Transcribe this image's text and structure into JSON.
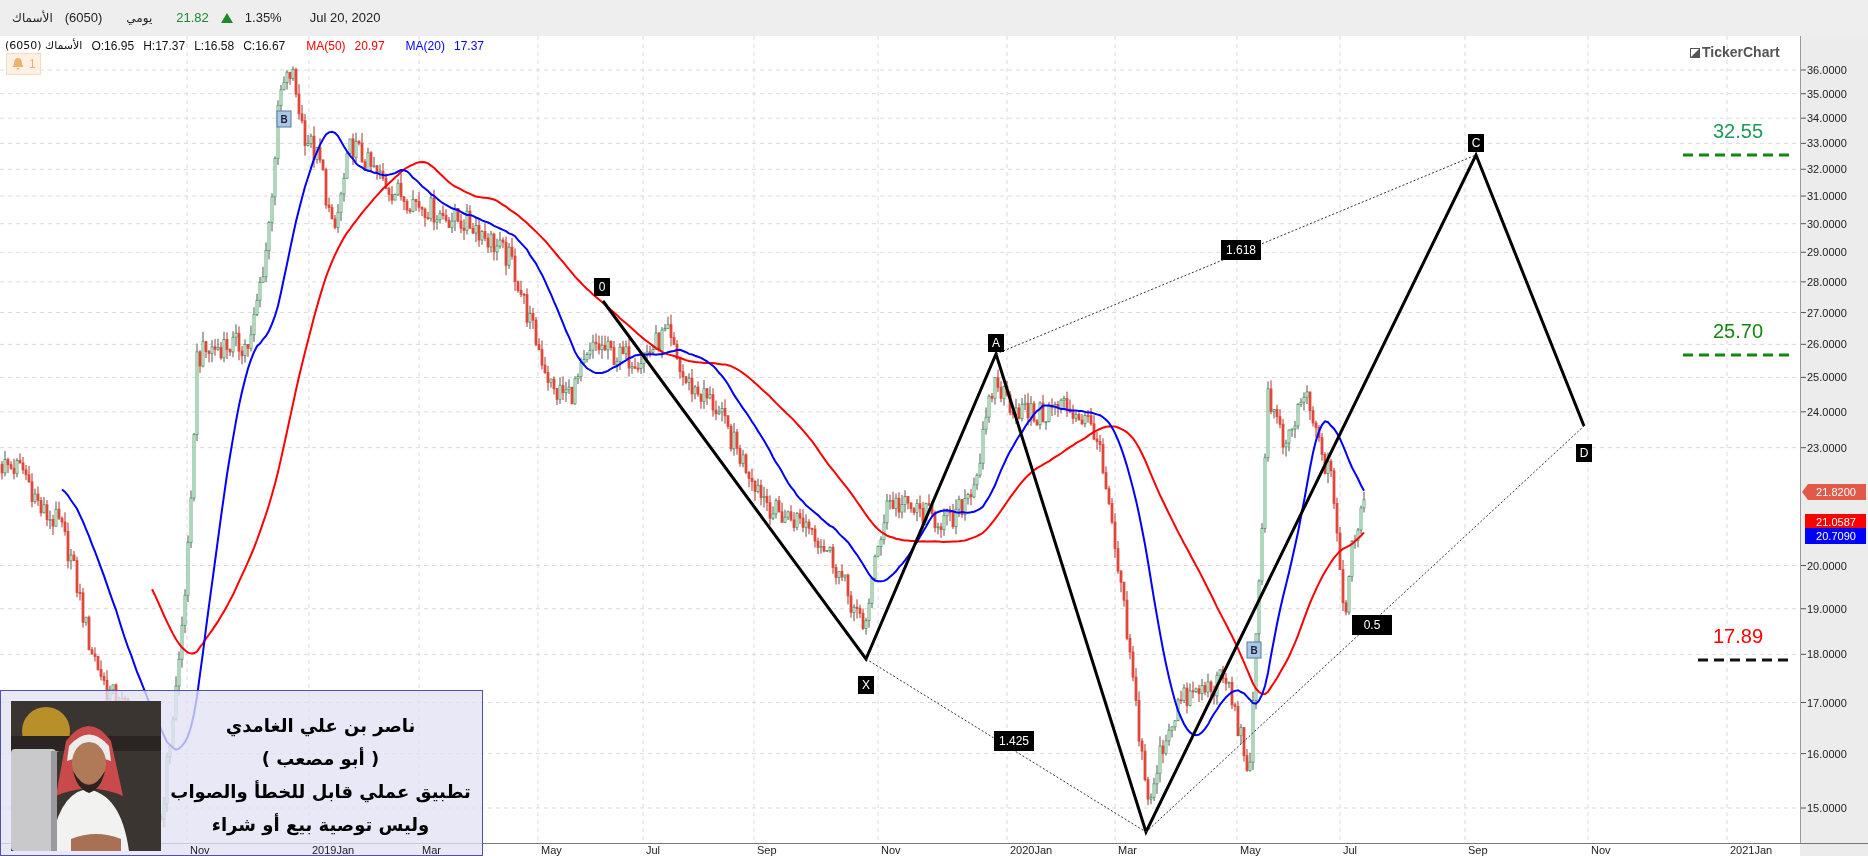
{
  "header": {
    "symbol_name": "الأسماك",
    "symbol_code": "(6050)",
    "period": "يومي",
    "last_price": "21.82",
    "change_up": true,
    "change_percent": "1.35%",
    "date": "Jul 20, 2020"
  },
  "chart": {
    "legend": {
      "symbol": "الأسماك (6050)",
      "ohlc": [
        "O:16.95",
        "H:17.37",
        "L:16.58",
        "C:16.67"
      ],
      "indicators": [
        {
          "name": "MA(50)",
          "value": "20.97",
          "color": "#ff0000"
        },
        {
          "name": "MA(20)",
          "value": "17.37",
          "color": "#0000ff"
        }
      ]
    },
    "alert_count": "1",
    "logo": "TickerChart",
    "y_ticks": [
      "36.0000",
      "35.0000",
      "34.0000",
      "33.0000",
      "32.0000",
      "31.0000",
      "30.0000",
      "29.0000",
      "28.0000",
      "27.0000",
      "26.0000",
      "25.0000",
      "24.0000",
      "23.0000",
      "20.0000",
      "19.0000",
      "18.0000",
      "17.0000",
      "16.0000",
      "15.0000"
    ],
    "x_ticks": [
      "Nov",
      "2019Jan",
      "Mar",
      "May",
      "Jul",
      "Sep",
      "Nov",
      "2020Jan",
      "Mar",
      "May",
      "Jul",
      "Sep",
      "Nov",
      "2021Jan"
    ],
    "price_tags": [
      {
        "text": "21.8200",
        "color": "#e05a47",
        "kind": "last"
      },
      {
        "text": "21.0587",
        "color": "#ff0000",
        "kind": "indicator"
      },
      {
        "text": "20.7090",
        "color": "#0000ff",
        "kind": "indicator"
      }
    ],
    "pattern_points": [
      "0",
      "X",
      "A",
      "C",
      "D"
    ],
    "ratios": [
      "1.618",
      "1.425",
      "0.5"
    ],
    "markers": [
      "B",
      "B"
    ],
    "levels": [
      {
        "value": "32.55",
        "color": "#1f9a5a",
        "kind": "target"
      },
      {
        "value": "25.70",
        "color": "#118811",
        "kind": "target"
      },
      {
        "value": "17.89",
        "color": "#ff0000",
        "kind": "stop"
      }
    ]
  },
  "overlay": {
    "lines": [
      "ناصر بن علي الغامدي",
      "( أبو مصعب )",
      "تطبيق عملي قابل للخطأ والصواب",
      "وليس توصية بيع أو شراء"
    ]
  }
}
